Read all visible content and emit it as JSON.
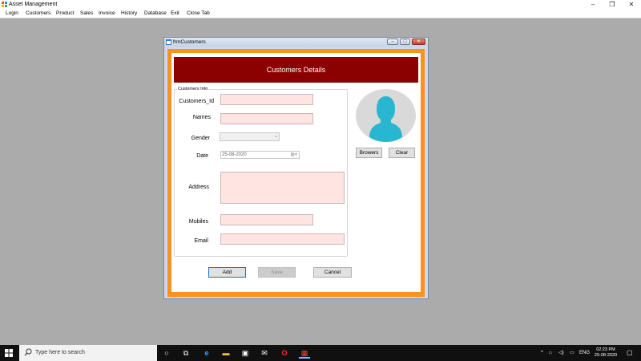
{
  "app": {
    "title": "Asset Management",
    "minimize": "‒",
    "maximize": "❐",
    "close": "✕"
  },
  "menu": [
    "Login",
    "Customers",
    "Product",
    "Sales",
    "Invoice",
    "History",
    "Database",
    "Exit",
    "Close Tab"
  ],
  "child_window": {
    "title": "frmCustomers",
    "header": "Customers Details",
    "group_title": "Customers Info",
    "labels": {
      "customers_id": "Customers_Id",
      "names": "Names",
      "gender": "Gender",
      "date": "Date",
      "address": "Address",
      "mobiles": "Mobiles",
      "email": "Email"
    },
    "values": {
      "customers_id": "",
      "names": "",
      "gender": "",
      "date": "25-08-2020",
      "address": "",
      "mobiles": "",
      "email": ""
    },
    "buttons": {
      "browse": "Browers",
      "clear": "Clear",
      "add": "Add",
      "save": "Save",
      "cancel": "Cancel"
    }
  },
  "taskbar": {
    "search_placeholder": "Type here to search",
    "language": "ENG",
    "time": "02:23 PM",
    "date": "25-08-2020"
  },
  "colors": {
    "banner": "#8b0000",
    "frame": "#f7931e",
    "input_bg": "#ffe4e1",
    "avatar_fill": "#29b6d1",
    "avatar_bg": "#d9d9d9"
  }
}
